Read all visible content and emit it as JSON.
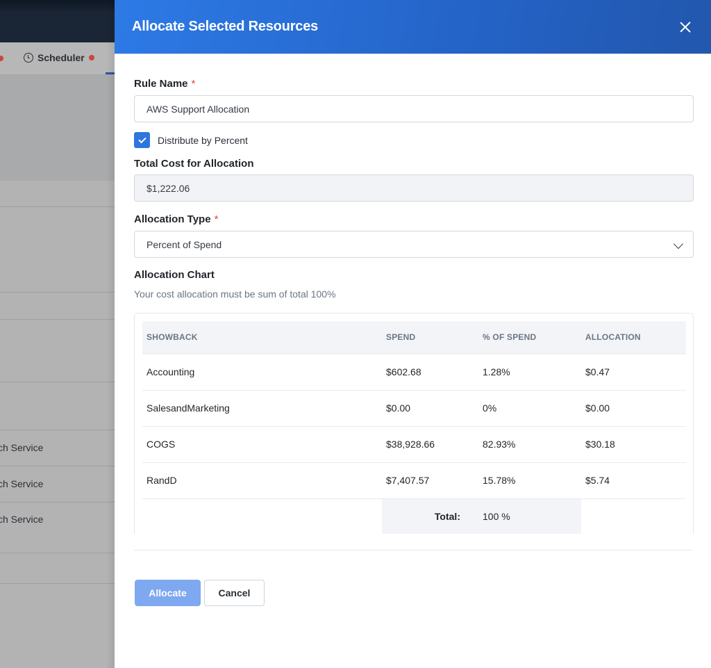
{
  "background_app": {
    "tab_label": "Scheduler",
    "row_texts": [
      "ch Service",
      "ch Service",
      "ch Service"
    ]
  },
  "drawer": {
    "title": "Allocate Selected Resources",
    "close_icon": "close-icon",
    "rule_name": {
      "label": "Rule Name",
      "required_mark": "*",
      "value": "AWS Support Allocation"
    },
    "distribute_by_percent": {
      "label": "Distribute by Percent",
      "checked": true
    },
    "total_cost": {
      "label": "Total Cost for Allocation",
      "value": "$1,222.06"
    },
    "allocation_type": {
      "label": "Allocation Type",
      "required_mark": "*",
      "selected": "Percent of Spend"
    },
    "allocation_chart": {
      "title": "Allocation Chart",
      "helper": "Your cost allocation must be sum of total 100%",
      "columns": [
        "SHOWBACK",
        "SPEND",
        "% OF SPEND",
        "ALLOCATION"
      ],
      "rows": [
        {
          "showback": "Accounting",
          "spend": "$602.68",
          "percent": "1.28%",
          "allocation": "$0.47"
        },
        {
          "showback": "SalesandMarketing",
          "spend": "$0.00",
          "percent": "0%",
          "allocation": "$0.00"
        },
        {
          "showback": "COGS",
          "spend": "$38,928.66",
          "percent": "82.93%",
          "allocation": "$30.18"
        },
        {
          "showback": "RandD",
          "spend": "$7,407.57",
          "percent": "15.78%",
          "allocation": "$5.74"
        }
      ],
      "total_label": "Total:",
      "total_value": "100 %"
    },
    "buttons": {
      "allocate": "Allocate",
      "cancel": "Cancel"
    }
  },
  "colors": {
    "header_blue": "#2d7ae6",
    "checkbox_blue": "#2f75de",
    "primary_disabled": "#7ea8ef",
    "required_red": "#e0463c",
    "status_dot_red": "#c9473d"
  }
}
